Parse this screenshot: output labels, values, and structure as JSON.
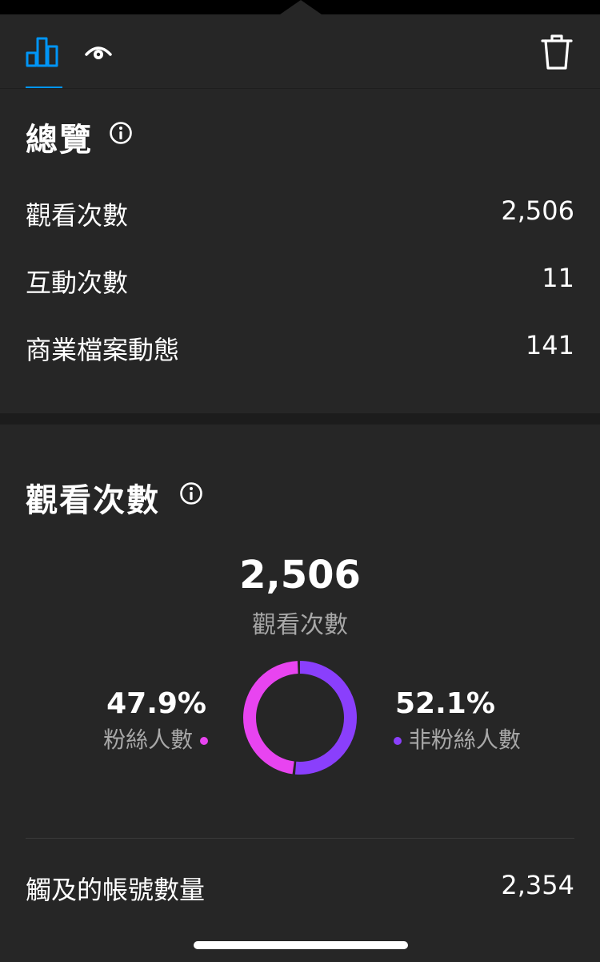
{
  "colors": {
    "accent": "#0095f6",
    "followers": "#e844f0",
    "non_followers": "#8a3ffc",
    "background": "#262626"
  },
  "tabs": {
    "icons": [
      "bar-chart-icon",
      "eye-icon",
      "trash-icon"
    ]
  },
  "overview": {
    "title": "總覽",
    "rows": [
      {
        "label": "觀看次數",
        "value": "2,506"
      },
      {
        "label": "互動次數",
        "value": "11"
      },
      {
        "label": "商業檔案動態",
        "value": "141"
      }
    ]
  },
  "views": {
    "title": "觀看次數",
    "total_value": "2,506",
    "total_label": "觀看次數",
    "followers_pct": "47.9%",
    "followers_label": "粉絲人數",
    "non_followers_pct": "52.1%",
    "non_followers_label": "非粉絲人數",
    "chart_data": {
      "type": "pie",
      "categories": [
        "粉絲人數",
        "非粉絲人數"
      ],
      "values": [
        47.9,
        52.1
      ]
    }
  },
  "reach": {
    "label": "觸及的帳號數量",
    "value": "2,354"
  }
}
